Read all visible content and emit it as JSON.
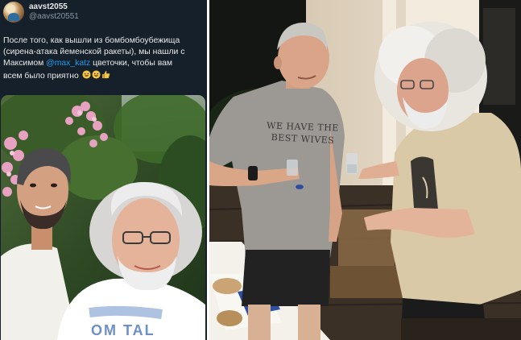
{
  "tweet": {
    "display_name": "aavst2055",
    "handle": "@aavst20551",
    "text_lines": [
      "После того, как вышли из бомбомбоубежища",
      "(сирена-атака йеменской ракеты), мы нашли с",
      "Максимом ",
      " цветочки, чтобы вам",
      "всем было приятно"
    ],
    "mention": "@max_katz",
    "emojis": [
      "grinning-sweat-emoji",
      "grinning-sweat-emoji",
      "thumbs-up-emoji"
    ]
  },
  "right_photo": {
    "shirt_text_line1": "WE HAVE THE",
    "shirt_text_line2": "BEST WIVES"
  },
  "colors": {
    "tweet_background": "#15202b",
    "text_primary": "#e7e9ea",
    "text_secondary": "#8b98a5",
    "link": "#1d9bf0"
  }
}
